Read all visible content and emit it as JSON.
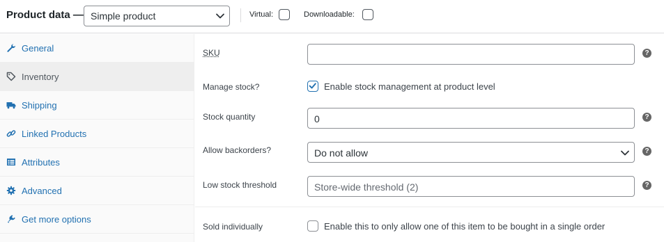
{
  "header": {
    "title": "Product data —",
    "product_type": "Simple product",
    "virtual_label": "Virtual:",
    "downloadable_label": "Downloadable:"
  },
  "sidebar": {
    "items": [
      {
        "label": "General",
        "icon": "wrench-icon"
      },
      {
        "label": "Inventory",
        "icon": "tag-icon"
      },
      {
        "label": "Shipping",
        "icon": "truck-icon"
      },
      {
        "label": "Linked Products",
        "icon": "link-icon"
      },
      {
        "label": "Attributes",
        "icon": "list-icon"
      },
      {
        "label": "Advanced",
        "icon": "gear-icon"
      },
      {
        "label": "Get more options",
        "icon": "plugin-icon"
      }
    ],
    "active": "Inventory"
  },
  "inventory": {
    "sku": {
      "label": "SKU",
      "value": ""
    },
    "manage_stock": {
      "label": "Manage stock?",
      "checkbox_label": "Enable stock management at product level",
      "checked": true
    },
    "stock_quantity": {
      "label": "Stock quantity",
      "value": "0"
    },
    "backorders": {
      "label": "Allow backorders?",
      "value": "Do not allow"
    },
    "low_stock": {
      "label": "Low stock threshold",
      "placeholder": "Store-wide threshold (2)"
    },
    "sold_individually": {
      "label": "Sold individually",
      "checkbox_label": "Enable this to only allow one of this item to be bought in a single order",
      "checked": false
    }
  },
  "help_glyph": "?",
  "colors": {
    "link": "#2271b1",
    "accent": "#2271b1",
    "border": "#8c8f94",
    "sidebar_bg": "#fafafa",
    "active_bg": "#eeeeee"
  }
}
